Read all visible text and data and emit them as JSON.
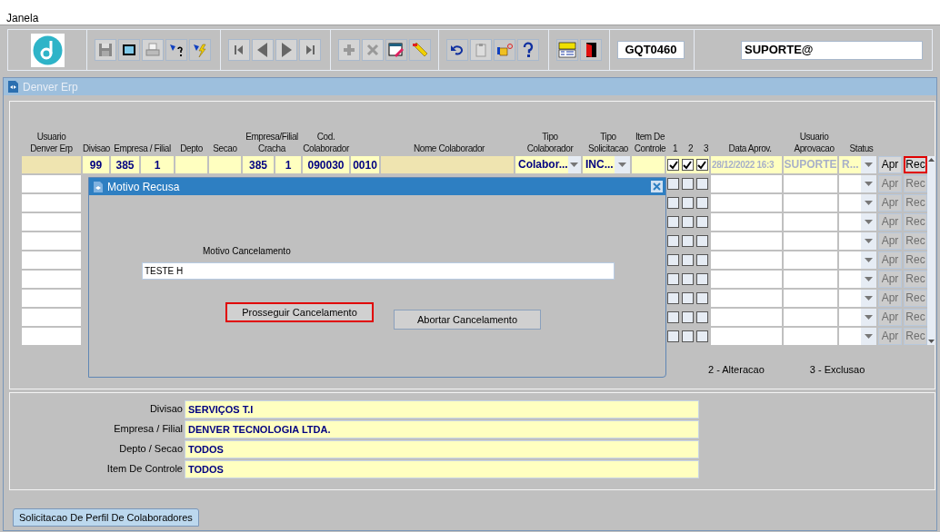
{
  "window": {
    "title": "Janela"
  },
  "toolbar": {
    "form_code": "GQT0460",
    "user": "SUPORTE@"
  },
  "panel": {
    "title": "Denver Erp"
  },
  "grid": {
    "columns": [
      "Usuario\nDenver Erp",
      "Divisao",
      "Empresa / Filial",
      "Depto",
      "Secao",
      "Empresa/Filial\nCracha",
      "Cod.\nColaborador",
      "Nome Colaborador",
      "Tipo\nColaborador",
      "Tipo\nSolicitacao",
      "Item De\nControle",
      "1",
      "2",
      "3",
      "Data Aprov.",
      "Usuario\nAprovacao",
      "Status"
    ],
    "rows": [
      {
        "kind": "record",
        "division": "99",
        "company": "385",
        "branch": "1",
        "badge_company": "385",
        "badge_branch": "1",
        "employee_code": "090030",
        "column_10": "0010",
        "employee_type": "Colabor...",
        "request_type": "INC...",
        "checks": [
          true,
          true,
          true
        ],
        "approval_date": "28/12/2022 16:3",
        "approved_by": "SUPORTE",
        "status": "R...",
        "buttons": [
          {
            "label": "Apr",
            "disabled": false,
            "highlighted": false
          },
          {
            "label": "Rec",
            "disabled": false,
            "highlighted": true
          }
        ]
      },
      {
        "kind": "blank",
        "checks": [
          false,
          false,
          false
        ],
        "buttons": [
          {
            "label": "Apr",
            "disabled": true,
            "highlighted": false
          },
          {
            "label": "Rec",
            "disabled": true,
            "highlighted": false
          }
        ]
      },
      {
        "kind": "blank",
        "checks": [
          false,
          false,
          false
        ],
        "buttons": [
          {
            "label": "Apr",
            "disabled": true,
            "highlighted": false
          },
          {
            "label": "Rec",
            "disabled": true,
            "highlighted": false
          }
        ]
      },
      {
        "kind": "blank",
        "checks": [
          false,
          false,
          false
        ],
        "buttons": [
          {
            "label": "Apr",
            "disabled": true,
            "highlighted": false
          },
          {
            "label": "Rec",
            "disabled": true,
            "highlighted": false
          }
        ]
      },
      {
        "kind": "blank",
        "checks": [
          false,
          false,
          false
        ],
        "buttons": [
          {
            "label": "Apr",
            "disabled": true,
            "highlighted": false
          },
          {
            "label": "Rec",
            "disabled": true,
            "highlighted": false
          }
        ]
      },
      {
        "kind": "blank",
        "checks": [
          false,
          false,
          false
        ],
        "buttons": [
          {
            "label": "Apr",
            "disabled": true,
            "highlighted": false
          },
          {
            "label": "Rec",
            "disabled": true,
            "highlighted": false
          }
        ]
      },
      {
        "kind": "blank",
        "checks": [
          false,
          false,
          false
        ],
        "buttons": [
          {
            "label": "Apr",
            "disabled": true,
            "highlighted": false
          },
          {
            "label": "Rec",
            "disabled": true,
            "highlighted": false
          }
        ]
      },
      {
        "kind": "blank",
        "checks": [
          false,
          false,
          false
        ],
        "buttons": [
          {
            "label": "Apr",
            "disabled": true,
            "highlighted": false
          },
          {
            "label": "Rec",
            "disabled": true,
            "highlighted": false
          }
        ]
      },
      {
        "kind": "blank",
        "checks": [
          false,
          false,
          false
        ],
        "buttons": [
          {
            "label": "Apr",
            "disabled": true,
            "highlighted": false
          },
          {
            "label": "Rec",
            "disabled": true,
            "highlighted": false
          }
        ]
      },
      {
        "kind": "blank",
        "checks": [
          false,
          false,
          false
        ],
        "buttons": [
          {
            "label": "Apr",
            "disabled": true,
            "highlighted": false
          },
          {
            "label": "Rec",
            "disabled": true,
            "highlighted": false
          }
        ]
      }
    ]
  },
  "legend": [
    "2 - Alteracao",
    "3 - Exclusao"
  ],
  "dialog": {
    "title": "Motivo Recusa",
    "field_label": "Motivo Cancelamento",
    "field_value": "TESTE H",
    "buttons": [
      {
        "label": "Prosseguir Cancelamento",
        "highlighted": true
      },
      {
        "label": "Abortar Cancelamento",
        "highlighted": false
      }
    ]
  },
  "filters": [
    {
      "label": "Divisao",
      "value": "SERVIÇOS T.I"
    },
    {
      "label": "Empresa / Filial",
      "value": "DENVER TECNOLOGIA LTDA."
    },
    {
      "label": "Depto / Secao",
      "value": "TODOS"
    },
    {
      "label": "Item De Controle",
      "value": "TODOS"
    }
  ],
  "tabs": [
    {
      "label": "Solicitacao De Perfil De Colaboradores",
      "selected": true
    }
  ]
}
